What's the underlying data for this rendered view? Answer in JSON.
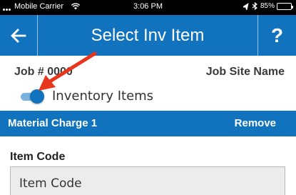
{
  "status_bar": {
    "carrier": "Mobile Carrier",
    "time": "3:06 PM",
    "battery_text": "85%",
    "battery_level": 0.85
  },
  "nav": {
    "title": "Select Inv Item",
    "help_label": "?",
    "back_icon": "arrow-left-icon"
  },
  "job": {
    "number": "Job # 0000",
    "site_name": "Job Site Name"
  },
  "inventory_toggle": {
    "label": "Inventory Items",
    "on": true
  },
  "section": {
    "title": "Material Charge 1",
    "remove_label": "Remove"
  },
  "item_code": {
    "label": "Item Code",
    "placeholder": "Item Code",
    "value": ""
  },
  "colors": {
    "brand": "#1172be",
    "annotation": "#e8361c"
  }
}
